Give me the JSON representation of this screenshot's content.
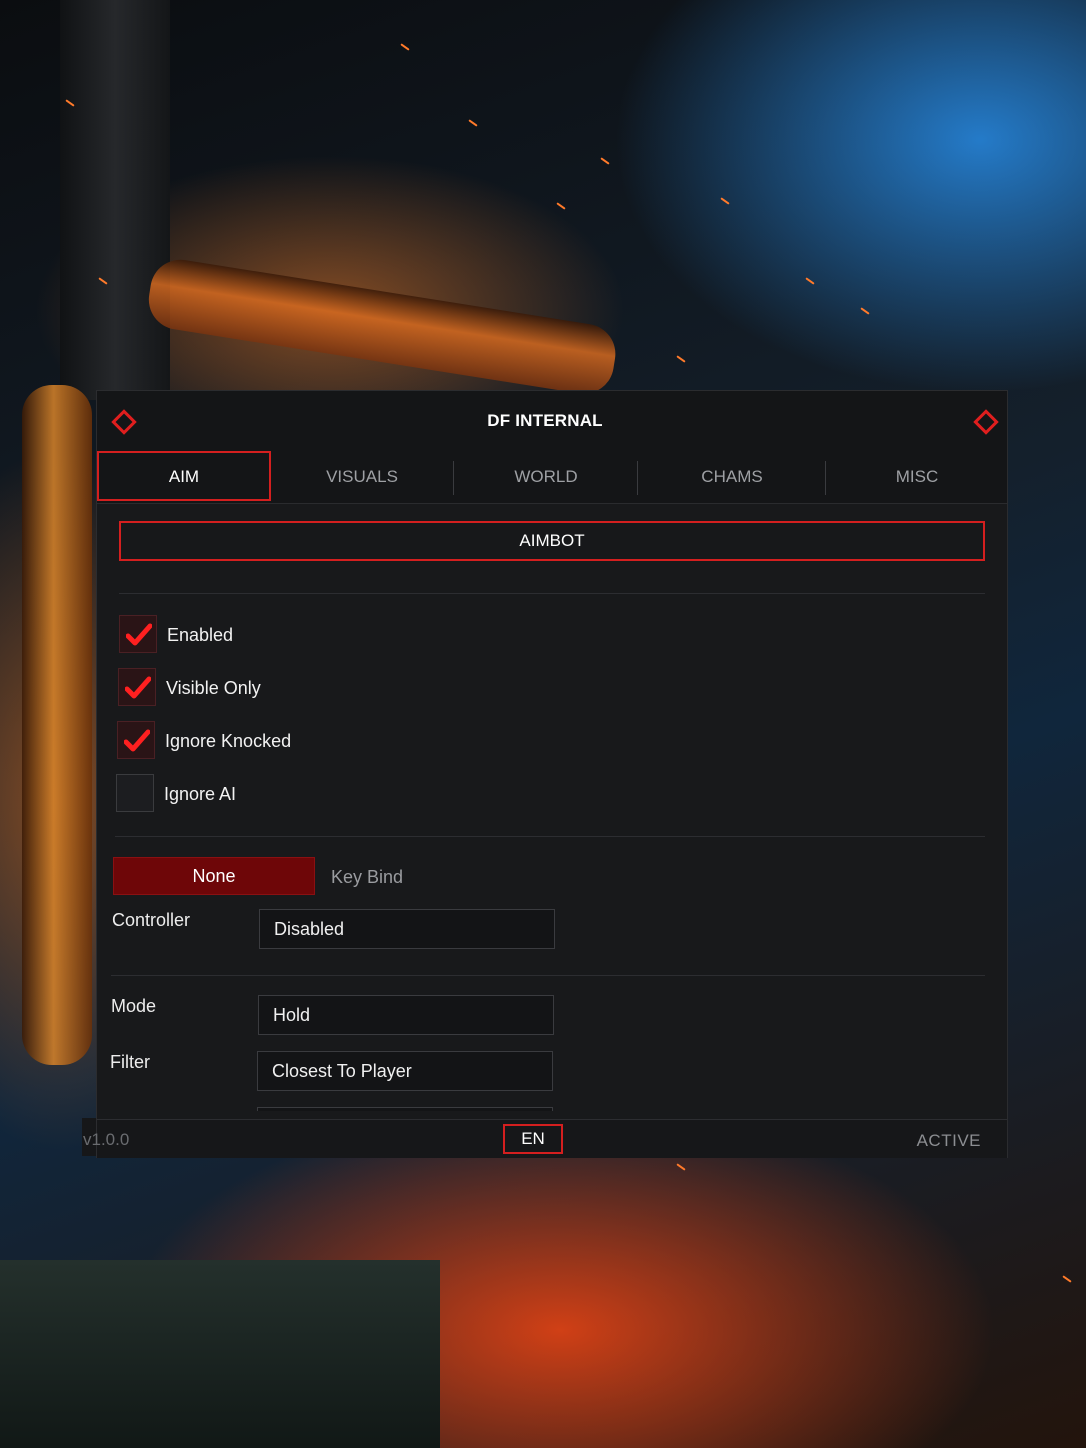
{
  "window": {
    "title": "DF INTERNAL"
  },
  "tabs": [
    {
      "label": "AIM",
      "active": true
    },
    {
      "label": "VISUALS",
      "active": false
    },
    {
      "label": "WORLD",
      "active": false
    },
    {
      "label": "CHAMS",
      "active": false
    },
    {
      "label": "MISC",
      "active": false
    }
  ],
  "section": {
    "label": "AIMBOT"
  },
  "options": [
    {
      "label": "Enabled",
      "checked": true
    },
    {
      "label": "Visible Only",
      "checked": true
    },
    {
      "label": "Ignore Knocked",
      "checked": true
    },
    {
      "label": "Ignore AI",
      "checked": false
    }
  ],
  "keybind": {
    "value": "None",
    "label": "Key Bind"
  },
  "controller": {
    "label": "Controller",
    "value": "Disabled"
  },
  "mode": {
    "label": "Mode",
    "value": "Hold"
  },
  "filter": {
    "label": "Filter",
    "value": "Closest To Player"
  },
  "footer": {
    "version": "v1.0.0",
    "language": "EN",
    "status": "ACTIVE"
  },
  "colors": {
    "accent": "#d41f1f",
    "keybind_bg": "#6e0608",
    "panel_bg": "#18191b"
  }
}
